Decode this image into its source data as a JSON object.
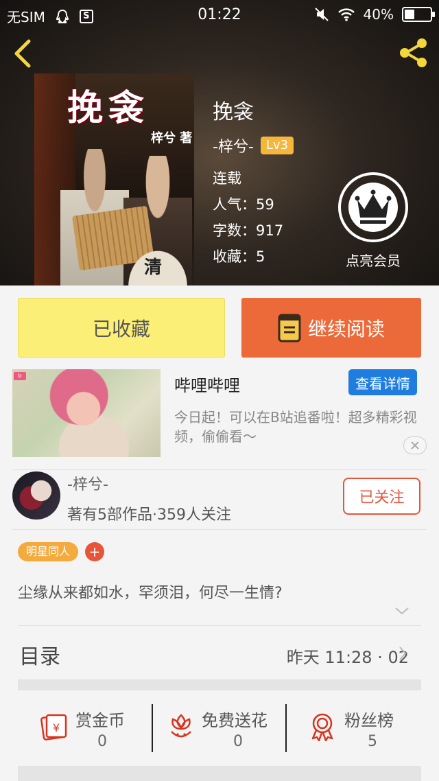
{
  "status_bar": {
    "carrier": "无SIM",
    "time": "01:22",
    "battery": "40%",
    "battery_level": 0.4
  },
  "book": {
    "title": "挽衾",
    "author": "-梓兮-",
    "level": "Lv3",
    "status": "连载",
    "popularity": "人气：59",
    "word_count": "字数：917",
    "favorites": "收藏：5",
    "cover_title": "挽衾",
    "cover_author": "梓兮 著",
    "cover_fan_text": "清"
  },
  "vip": {
    "label": "点亮会员"
  },
  "actions": {
    "collected_label": "已收藏",
    "read_label": "继续阅读"
  },
  "ad": {
    "title": "哔哩哔哩",
    "detail_button": "查看详情",
    "description": "今日起！可以在B站追番啦！超多精彩视频，偷偷看～"
  },
  "author_card": {
    "name": "-梓兮-",
    "meta": "著有5部作品·359人关注",
    "follow_label": "已关注"
  },
  "tags": [
    "明星同人"
  ],
  "tag_add": "+",
  "intro": "尘缘从来都如水，罕须泪，何尽一生情?",
  "toc": {
    "label": "目录",
    "update": "昨天 11:28 · 02"
  },
  "bottom_stats": [
    {
      "label": "赏金币",
      "value": "0",
      "icon": "coin-envelope-icon"
    },
    {
      "label": "免费送花",
      "value": "0",
      "icon": "flower-icon"
    },
    {
      "label": "粉丝榜",
      "value": "5",
      "icon": "medal-icon"
    }
  ],
  "colors": {
    "collected_bg": "#fbef77",
    "read_bg": "#ec6a3a",
    "accent_red": "#e6553a",
    "tag_orange": "#f4aa3c",
    "ad_blue": "#1f7de0",
    "level_badge": "#f5b73b"
  }
}
